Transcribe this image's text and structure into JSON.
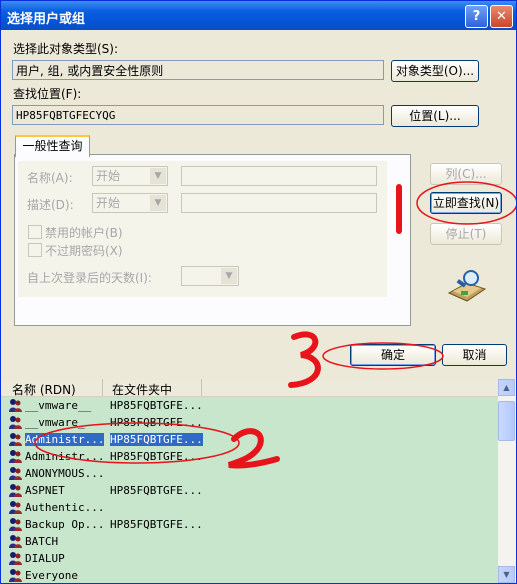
{
  "window": {
    "title": "选择用户或组",
    "help_icon": "?",
    "close_icon": "✕"
  },
  "object_type": {
    "label": "选择此对象类型(S):",
    "value": "用户, 组, 或内置安全性原则",
    "button": "对象类型(O)..."
  },
  "location": {
    "label": "查找位置(F):",
    "value": "HP85FQBTGFECYQG",
    "button": "位置(L)..."
  },
  "tab": {
    "label": "一般性查询"
  },
  "query": {
    "name_label": "名称(A):",
    "name_op": "开始",
    "desc_label": "描述(D):",
    "desc_op": "开始",
    "disabled_accounts": "禁用的帐户(B)",
    "no_expire_pwd": "不过期密码(X)",
    "days_label": "自上次登录后的天数(I):"
  },
  "buttons": {
    "columns": "列(C)...",
    "find_now": "立即查找(N)",
    "stop": "停止(T)",
    "ok": "确定",
    "cancel": "取消"
  },
  "annotations": {
    "one": "1",
    "two": "2",
    "three": "3"
  },
  "results": {
    "columns": [
      "名称 (RDN)",
      "在文件夹中"
    ],
    "rows": [
      {
        "name": "__vmware__",
        "folder": "HP85FQBTGFE..."
      },
      {
        "name": "__vmware_",
        "folder": "HP85FQBTGFE..."
      },
      {
        "name": "Administr...",
        "folder": "HP85FQBTGFE...",
        "selected": true
      },
      {
        "name": "Administr...",
        "folder": "HP85FQBTGFE..."
      },
      {
        "name": "ANONYMOUS...",
        "folder": ""
      },
      {
        "name": "ASPNET",
        "folder": "HP85FQBTGFE..."
      },
      {
        "name": "Authentic...",
        "folder": ""
      },
      {
        "name": "Backup Op...",
        "folder": "HP85FQBTGFE..."
      },
      {
        "name": "BATCH",
        "folder": ""
      },
      {
        "name": "DIALUP",
        "folder": ""
      },
      {
        "name": "Everyone",
        "folder": ""
      }
    ]
  },
  "colors": {
    "titlebar": "#0554d6",
    "list_bg": "#c8e6cc",
    "selection": "#316ac5",
    "annotation": "#e8141c"
  }
}
